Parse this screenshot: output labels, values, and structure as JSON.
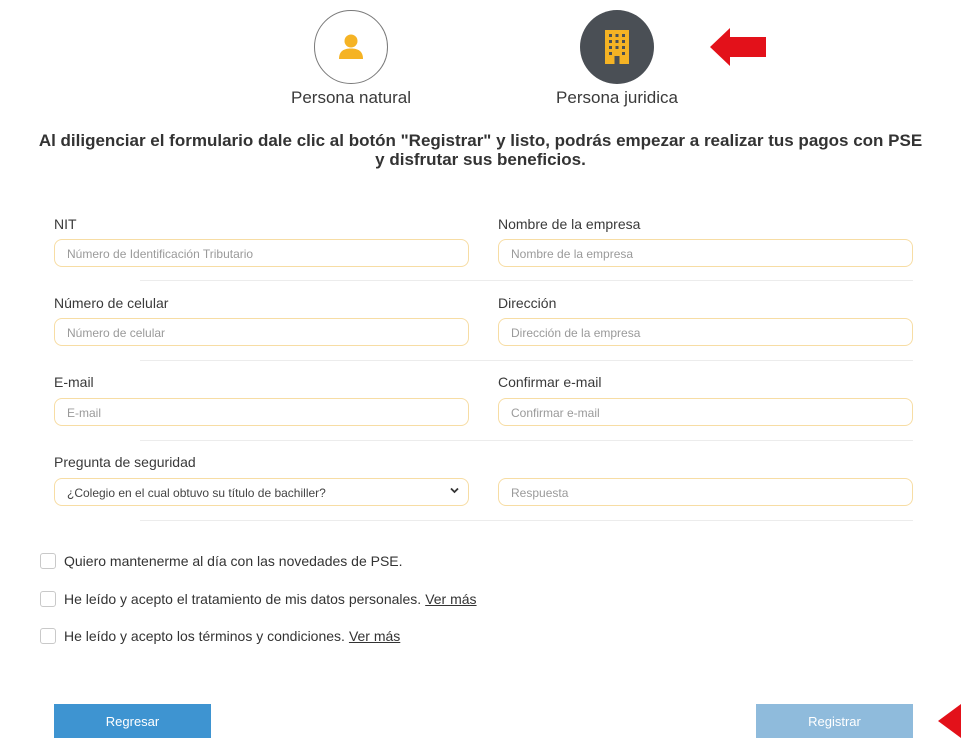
{
  "persona": {
    "natural_label": "Persona natural",
    "juridica_label": "Persona juridica",
    "natural_icon": "person-icon",
    "juridica_icon": "building-icon",
    "icon_color": "#f5b324",
    "arrow_color": "#e3111a"
  },
  "intro": {
    "line1": "Al diligenciar el formulario dale clic al botón \"Registrar\" y listo, podrás empezar a realizar tus pagos con PSE",
    "line2": "y disfrutar sus beneficios."
  },
  "form": {
    "nit": {
      "label": "NIT",
      "placeholder": "Número de Identificación Tributario"
    },
    "empresa": {
      "label": "Nombre de la empresa",
      "placeholder": "Nombre de la empresa"
    },
    "celular": {
      "label": "Número de celular",
      "placeholder": "Número de celular"
    },
    "direccion": {
      "label": "Dirección",
      "placeholder": "Dirección de la empresa"
    },
    "email": {
      "label": "E-mail",
      "placeholder": "E-mail"
    },
    "confirm_email": {
      "label": "Confirmar e-mail",
      "placeholder": "Confirmar e-mail"
    },
    "pregunta": {
      "label": "Pregunta de seguridad",
      "selected": "¿Colegio en el cual obtuvo su título de bachiller?"
    },
    "respuesta": {
      "placeholder": "Respuesta"
    }
  },
  "checks": {
    "novedades": "Quiero mantenerme al día con las novedades de PSE.",
    "datos": "He leído y acepto el tratamiento de mis datos personales.",
    "terminos": "He leído y acepto los términos y condiciones.",
    "ver_mas": "Ver más"
  },
  "buttons": {
    "back": "Regresar",
    "register": "Registrar"
  }
}
